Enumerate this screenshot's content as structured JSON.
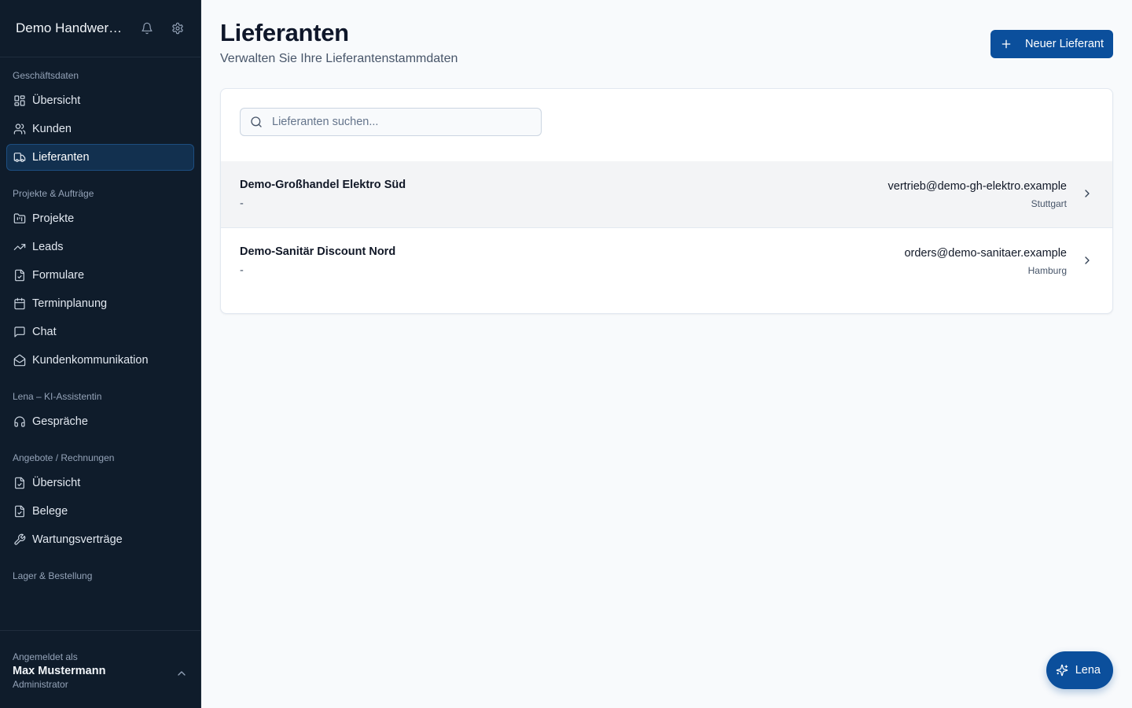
{
  "sidebar": {
    "title": "Demo Handwerksbetrieb",
    "sections": [
      {
        "label": "Geschäftsdaten",
        "items": [
          {
            "label": "Übersicht",
            "icon": "dashboard-icon"
          },
          {
            "label": "Kunden",
            "icon": "users-icon"
          },
          {
            "label": "Lieferanten",
            "icon": "truck-icon",
            "active": true
          }
        ]
      },
      {
        "label": "Projekte & Aufträge",
        "items": [
          {
            "label": "Projekte",
            "icon": "folder-icon"
          },
          {
            "label": "Leads",
            "icon": "trending-up-icon"
          },
          {
            "label": "Formulare",
            "icon": "form-icon"
          },
          {
            "label": "Terminplanung",
            "icon": "calendar-icon"
          },
          {
            "label": "Chat",
            "icon": "chat-icon"
          },
          {
            "label": "Kundenkommunikation",
            "icon": "mail-open-icon"
          }
        ]
      },
      {
        "label": "Lena – KI-Assistentin",
        "items": [
          {
            "label": "Gespräche",
            "icon": "headphones-icon"
          }
        ]
      },
      {
        "label": "Angebote / Rechnungen",
        "items": [
          {
            "label": "Übersicht",
            "icon": "file-check-icon"
          },
          {
            "label": "Belege",
            "icon": "receipt-icon"
          },
          {
            "label": "Wartungsverträge",
            "icon": "wrench-icon"
          }
        ]
      },
      {
        "label": "Lager & Bestellung",
        "items": []
      }
    ],
    "footer": {
      "label": "Angemeldet als",
      "name": "Max Mustermann",
      "role": "Administrator"
    }
  },
  "header": {
    "title": "Lieferanten",
    "subtitle": "Verwalten Sie Ihre Lieferantenstammdaten",
    "new_button": "Neuer Lieferant"
  },
  "search": {
    "placeholder": "Lieferanten suchen..."
  },
  "suppliers": [
    {
      "name": "Demo-Großhandel Elektro Süd",
      "sub": "-",
      "email": "vertrieb@demo-gh-elektro.example",
      "city": "Stuttgart"
    },
    {
      "name": "Demo-Sanitär Discount Nord",
      "sub": "-",
      "email": "orders@demo-sanitaer.example",
      "city": "Hamburg"
    }
  ],
  "fab": {
    "label": "Lena"
  },
  "colors": {
    "sidebar_bg": "#0f1c2b",
    "accent": "#0b4f9c",
    "page_bg": "#f8fafc"
  }
}
